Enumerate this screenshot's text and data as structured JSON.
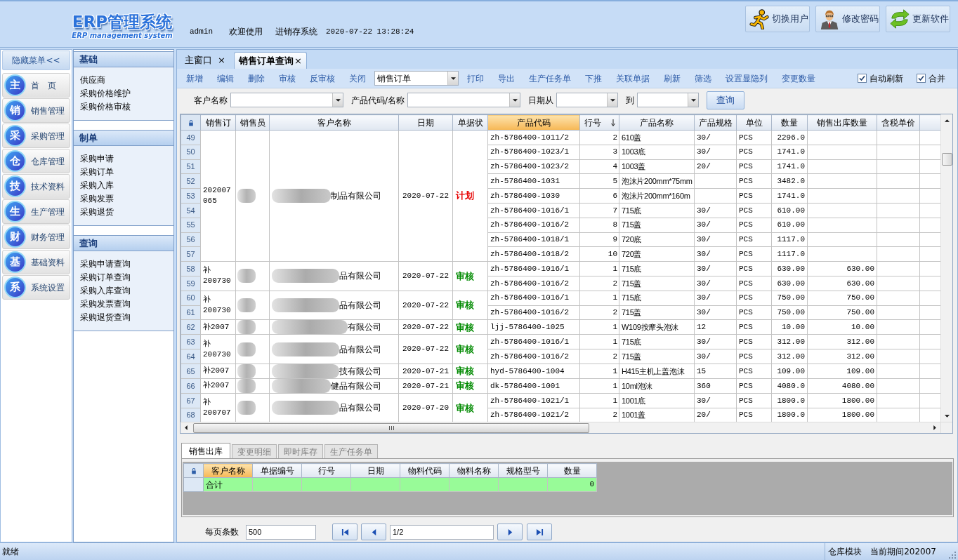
{
  "header": {
    "logo": {
      "title": "ERP管理系统",
      "subtitle": "ERP management system"
    },
    "user": "admin",
    "welcome": "欢迎使用",
    "system": "进销存系统",
    "datetime": "2020-07-22 13:28:24",
    "buttons": [
      {
        "kind": "switch_user",
        "label": "切换用户"
      },
      {
        "kind": "password",
        "label": "修改密码"
      },
      {
        "kind": "update",
        "label": "更新软件"
      }
    ]
  },
  "nav": {
    "toggle": "隐藏菜单<<",
    "modules": [
      {
        "badge": "主",
        "label": "首　页"
      },
      {
        "badge": "销",
        "label": "销售管理"
      },
      {
        "badge": "采",
        "label": "采购管理"
      },
      {
        "badge": "仓",
        "label": "仓库管理"
      },
      {
        "badge": "技",
        "label": "技术资料"
      },
      {
        "badge": "生",
        "label": "生产管理"
      },
      {
        "badge": "财",
        "label": "财务管理"
      },
      {
        "badge": "基",
        "label": "基础资料"
      },
      {
        "badge": "系",
        "label": "系统设置"
      }
    ]
  },
  "submenu": {
    "sections": [
      {
        "title": "基础",
        "items": [
          "供应商",
          "采购价格维护",
          "采购价格审核"
        ]
      },
      {
        "title": "制单",
        "items": [
          "采购申请",
          "采购订单",
          "采购入库",
          "采购发票",
          "采购退货"
        ]
      },
      {
        "title": "查询",
        "items": [
          "采购申请查询",
          "采购订单查询",
          "采购入库查询",
          "采购发票查询",
          "采购退货查询"
        ]
      }
    ]
  },
  "tabs": [
    {
      "label": "主窗口",
      "close": "×",
      "selected": false
    },
    {
      "label": "销售订单查询",
      "close": "×",
      "selected": true
    }
  ],
  "toolbar": {
    "items": [
      {
        "kind": "button",
        "label": "新增"
      },
      {
        "kind": "button",
        "label": "编辑"
      },
      {
        "kind": "button",
        "label": "删除"
      },
      {
        "kind": "button",
        "label": "审核"
      },
      {
        "kind": "button",
        "label": "反审核"
      },
      {
        "kind": "button",
        "label": "关闭"
      },
      {
        "kind": "combo",
        "value": "销售订单"
      },
      {
        "kind": "button",
        "label": "打印"
      },
      {
        "kind": "button",
        "label": "导出"
      },
      {
        "kind": "button",
        "label": "生产任务单"
      },
      {
        "kind": "button",
        "label": "下推"
      },
      {
        "kind": "button",
        "label": "关联单据"
      },
      {
        "kind": "button",
        "label": "刷新"
      },
      {
        "kind": "button",
        "label": "筛选"
      },
      {
        "kind": "button",
        "label": "设置显隐列"
      },
      {
        "kind": "button",
        "label": "变更数量"
      }
    ],
    "checkboxes": [
      {
        "label": "自动刷新",
        "checked": true
      },
      {
        "label": "合并",
        "checked": true
      }
    ]
  },
  "filters": {
    "fields": [
      {
        "kind": "text",
        "label": "客户名称"
      },
      {
        "kind": "text",
        "label": "产品代码/名称"
      },
      {
        "kind": "date",
        "label": "日期从"
      },
      {
        "kind": "date",
        "label": "到"
      }
    ],
    "button": "查询"
  },
  "grid": {
    "columns": [
      {
        "label": "销售订",
        "selected": false,
        "sorted": false
      },
      {
        "label": "销售员",
        "selected": false,
        "sorted": false
      },
      {
        "label": "客户名称",
        "selected": false,
        "sorted": false
      },
      {
        "label": "日期",
        "selected": false,
        "sorted": false
      },
      {
        "label": "单据状",
        "selected": false,
        "sorted": false
      },
      {
        "label": "产品代码",
        "selected": true,
        "sorted": false
      },
      {
        "label": "行号",
        "selected": false,
        "sorted": true
      },
      {
        "label": "产品名称",
        "selected": false,
        "sorted": false
      },
      {
        "label": "产品规格",
        "selected": false,
        "sorted": false
      },
      {
        "label": "单位",
        "selected": false,
        "sorted": false
      },
      {
        "label": "数量",
        "selected": false,
        "sorted": false
      },
      {
        "label": "销售出库数量",
        "selected": false,
        "sorted": false
      },
      {
        "label": "含税单价",
        "selected": false,
        "sorted": false
      }
    ],
    "groups": [
      {
        "order_no": [
          "202007",
          "065"
        ],
        "customer": "制品有限公司",
        "date": "2020-07-22",
        "status": {
          "label": "计划",
          "kind": "plan"
        },
        "rows": [
          {
            "num": "49",
            "code": "zh-5786400-1011/2",
            "line": "2",
            "name": "610盖",
            "spec": "30/",
            "unit": "PCS",
            "qty": "2296.0"
          },
          {
            "num": "50",
            "code": "zh-5786400-1023/1",
            "line": "3",
            "name": "1003底",
            "spec": "30/",
            "unit": "PCS",
            "qty": "1741.0"
          },
          {
            "num": "51",
            "code": "zh-5786400-1023/2",
            "line": "4",
            "name": "1003盖",
            "spec": "20/",
            "unit": "PCS",
            "qty": "1741.0"
          },
          {
            "num": "52",
            "code": "zh-5786400-1031",
            "line": "5",
            "name": "泡沫片200mm*75mm",
            "unit": "PCS",
            "qty": "3482.0"
          },
          {
            "num": "53",
            "code": "zh-5786400-1030",
            "line": "6",
            "name": "泡沫片200mm*160m",
            "unit": "PCS",
            "qty": "1741.0"
          },
          {
            "num": "54",
            "code": "zh-5786400-1016/1",
            "line": "7",
            "name": "715底",
            "spec": "30/",
            "unit": "PCS",
            "qty": "610.00"
          },
          {
            "num": "55",
            "code": "zh-5786400-1016/2",
            "line": "8",
            "name": "715盖",
            "spec": "30/",
            "unit": "PCS",
            "qty": "610.00"
          },
          {
            "num": "56",
            "code": "zh-5786400-1018/1",
            "line": "9",
            "name": "720底",
            "spec": "30/",
            "unit": "PCS",
            "qty": "1117.0"
          },
          {
            "num": "57",
            "code": "zh-5786400-1018/2",
            "line": "10",
            "name": "720盖",
            "spec": "30/",
            "unit": "PCS",
            "qty": "1117.0"
          }
        ]
      },
      {
        "order_no": [
          "补",
          "200730"
        ],
        "customer": "品有限公司",
        "date": "2020-07-22",
        "status": {
          "label": "审核",
          "kind": "approved"
        },
        "rows": [
          {
            "num": "58",
            "code": "zh-5786400-1016/1",
            "line": "1",
            "name": "715底",
            "spec": "30/",
            "unit": "PCS",
            "qty": "630.00",
            "out_qty": "630.00"
          },
          {
            "num": "59",
            "code": "zh-5786400-1016/2",
            "line": "2",
            "name": "715盖",
            "spec": "30/",
            "unit": "PCS",
            "qty": "630.00",
            "out_qty": "630.00"
          }
        ]
      },
      {
        "order_no": [
          "补",
          "200730"
        ],
        "customer": "品有限公司",
        "date": "2020-07-22",
        "status": {
          "label": "审核",
          "kind": "approved"
        },
        "rows": [
          {
            "num": "60",
            "code": "zh-5786400-1016/1",
            "line": "1",
            "name": "715底",
            "spec": "30/",
            "unit": "PCS",
            "qty": "750.00",
            "out_qty": "750.00"
          },
          {
            "num": "61",
            "code": "zh-5786400-1016/2",
            "line": "2",
            "name": "715盖",
            "spec": "30/",
            "unit": "PCS",
            "qty": "750.00",
            "out_qty": "750.00"
          }
        ]
      },
      {
        "order_no": [
          "补2007"
        ],
        "customer": "有限公司",
        "date": "2020-07-22",
        "status": {
          "label": "审核",
          "kind": "approved"
        },
        "rows": [
          {
            "num": "62",
            "code": "ljj-5786400-1025",
            "line": "1",
            "name": "W109按摩头泡沫",
            "spec": "12",
            "unit": "PCS",
            "qty": "10.00",
            "out_qty": "10.00"
          }
        ]
      },
      {
        "order_no": [
          "补",
          "200730"
        ],
        "customer": "品有限公司",
        "date": "2020-07-22",
        "status": {
          "label": "审核",
          "kind": "approved"
        },
        "rows": [
          {
            "num": "63",
            "code": "zh-5786400-1016/1",
            "line": "1",
            "name": "715底",
            "spec": "30/",
            "unit": "PCS",
            "qty": "312.00",
            "out_qty": "312.00"
          },
          {
            "num": "64",
            "code": "zh-5786400-1016/2",
            "line": "2",
            "name": "715盖",
            "spec": "30/",
            "unit": "PCS",
            "qty": "312.00",
            "out_qty": "312.00"
          }
        ]
      },
      {
        "order_no": [
          "补2007"
        ],
        "customer": "技有限公司",
        "date": "2020-07-21",
        "status": {
          "label": "审核",
          "kind": "approved"
        },
        "rows": [
          {
            "num": "65",
            "code": "hyd-5786400-1004",
            "line": "1",
            "name": "H415主机上盖泡沫",
            "spec": "15",
            "unit": "PCS",
            "qty": "109.00",
            "out_qty": "109.00"
          }
        ]
      },
      {
        "order_no": [
          "补2007"
        ],
        "customer": "健品有限公司",
        "date": "2020-07-21",
        "status": {
          "label": "审核",
          "kind": "approved"
        },
        "rows": [
          {
            "num": "66",
            "code": "dk-5786400-1001",
            "line": "1",
            "name": "10ml泡沫",
            "spec": "360",
            "unit": "PCS",
            "qty": "4080.0",
            "out_qty": "4080.00"
          }
        ]
      },
      {
        "order_no": [
          "补",
          "200707"
        ],
        "customer": "品有限公司",
        "date": "2020-07-20",
        "status": {
          "label": "审核",
          "kind": "approved"
        },
        "rows": [
          {
            "num": "67",
            "code": "zh-5786400-1021/1",
            "line": "1",
            "name": "1001底",
            "spec": "30/",
            "unit": "PCS",
            "qty": "1800.0",
            "out_qty": "1800.00"
          },
          {
            "num": "68",
            "code": "zh-5786400-1021/2",
            "line": "2",
            "name": "1001盖",
            "spec": "20/",
            "unit": "PCS",
            "qty": "1800.0",
            "out_qty": "1800.00"
          }
        ]
      }
    ]
  },
  "detail_tabs": [
    {
      "label": "销售出库",
      "selected": true
    },
    {
      "label": "变更明细",
      "selected": false
    },
    {
      "label": "即时库存",
      "selected": false
    },
    {
      "label": "生产任务单",
      "selected": false
    }
  ],
  "detail_grid": {
    "columns": [
      {
        "label": "客户名称",
        "selected": true
      },
      {
        "label": "单据编号",
        "selected": false
      },
      {
        "label": "行号",
        "selected": false
      },
      {
        "label": "日期",
        "selected": false
      },
      {
        "label": "物料代码",
        "selected": false
      },
      {
        "label": "物料名称",
        "selected": false
      },
      {
        "label": "规格型号",
        "selected": false
      },
      {
        "label": "数量",
        "selected": false
      }
    ],
    "total": {
      "label": "合计",
      "quantity": "0"
    }
  },
  "pager": {
    "page_size_label": "每页条数",
    "page_size": "500",
    "page": "1/2"
  },
  "status_bar": {
    "status": "就绪",
    "module": "仓库模块",
    "period": "当前期间202007"
  }
}
